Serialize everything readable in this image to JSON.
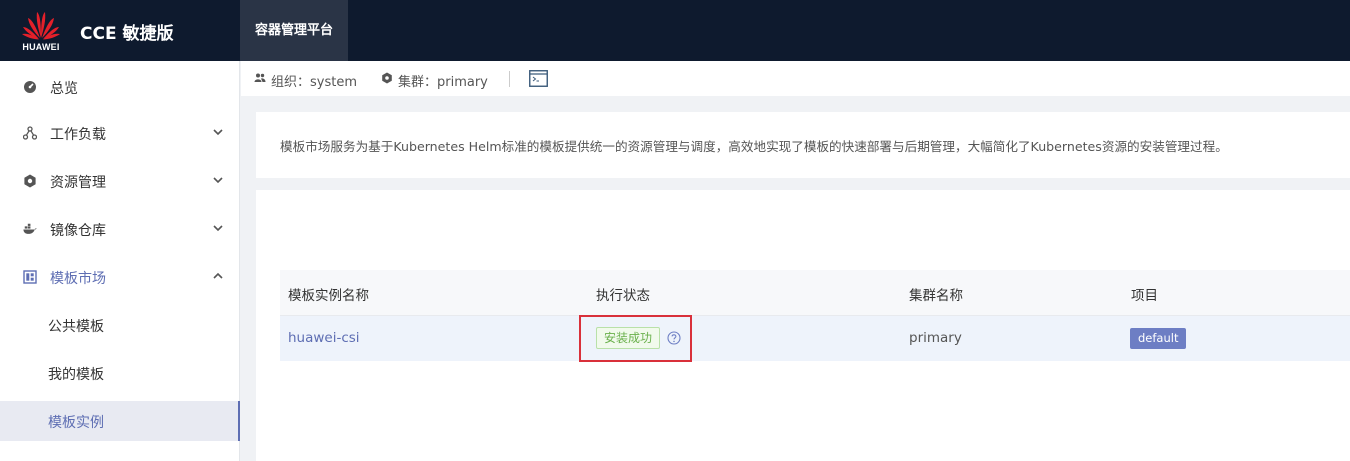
{
  "header": {
    "brand": "HUAWEI",
    "product_title": "CCE 敏捷版",
    "active_tab": "容器管理平台"
  },
  "sidebar": {
    "items": [
      {
        "label": "总览",
        "icon": "dashboard-icon"
      },
      {
        "label": "工作负载",
        "icon": "workload-icon",
        "expanded": false
      },
      {
        "label": "资源管理",
        "icon": "resource-icon",
        "expanded": false
      },
      {
        "label": "镜像仓库",
        "icon": "docker-icon",
        "expanded": false
      },
      {
        "label": "模板市场",
        "icon": "template-market-icon",
        "expanded": true
      }
    ],
    "sub_items": [
      {
        "label": "公共模板",
        "active": false
      },
      {
        "label": "我的模板",
        "active": false
      },
      {
        "label": "模板实例",
        "active": true
      }
    ]
  },
  "infobar": {
    "org_label": "组织：system",
    "cluster_label": "集群：primary"
  },
  "description": "模板市场服务为基于Kubernetes Helm标准的模板提供统一的资源管理与调度，高效地实现了模板的快速部署与后期管理，大幅简化了Kubernetes资源的安装管理过程。",
  "table": {
    "headers": [
      "模板实例名称",
      "执行状态",
      "集群名称",
      "项目"
    ],
    "rows": [
      {
        "name": "huawei-csi",
        "status": "安装成功",
        "cluster": "primary",
        "project": "default"
      }
    ]
  },
  "colors": {
    "topbar": "#0e1a2e",
    "accent": "#5e6eb3",
    "success": "#6ab04c",
    "highlight": "#d9303a"
  }
}
